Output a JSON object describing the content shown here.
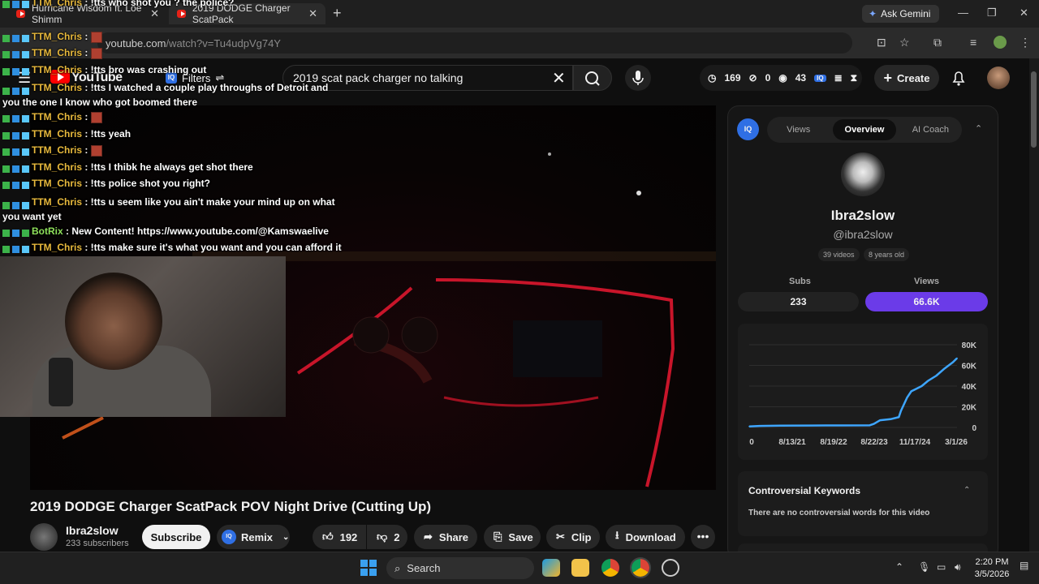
{
  "browser": {
    "tabs": [
      {
        "title": "Hurricane Wisdom ft. Loe Shimm"
      },
      {
        "title": "2019 DODGE Charger ScatPack"
      }
    ],
    "gemini_label": "Ask Gemini",
    "url_host": "youtube.com",
    "url_path": "/watch?v=Tu4udpVg74Y"
  },
  "youtube": {
    "logo_text": "YouTube",
    "filters_label": "Filters",
    "search_query": "2019 scat pack charger no talking",
    "stats": {
      "time": "169",
      "zero": "0",
      "count": "43"
    },
    "create_label": "Create"
  },
  "chat": [
    {
      "user": "TTM_Chris",
      "msg": " : !tts who shot you ? the police?",
      "emote": false
    },
    {
      "user": "TTM_Chris",
      "msg": " :",
      "emote": true
    },
    {
      "user": "TTM_Chris",
      "msg": " :",
      "emote": true
    },
    {
      "user": "TTM_Chris",
      "msg": " : !tts bro was crashing out",
      "emote": false
    },
    {
      "user": "TTM_Chris",
      "msg": " : !tts I watched a couple play throughs of Detroit and you the one I know who got boomed there",
      "emote": false
    },
    {
      "user": "TTM_Chris",
      "msg": " :",
      "emote": true
    },
    {
      "user": "TTM_Chris",
      "msg": " : !tts yeah",
      "emote": false
    },
    {
      "user": "TTM_Chris",
      "msg": " :",
      "emote": true
    },
    {
      "user": "TTM_Chris",
      "msg": " : !tts I thibk he always get shot there",
      "emote": false
    },
    {
      "user": "TTM_Chris",
      "msg": " : !tts police shot you right?",
      "emote": false
    },
    {
      "user": "TTM_Chris",
      "msg": " : !tts u seem like you ain't make your mind up on what you want yet",
      "emote": false
    },
    {
      "user": "BotRix",
      "msg": " : New Content! https://www.youtube.com/@Kamswaelive",
      "emote": false
    },
    {
      "user": "TTM_Chris",
      "msg": " : !tts make sure it's what you want and you can afford it",
      "emote": false
    }
  ],
  "video": {
    "title": "2019 DODGE Charger ScatPack POV Night Drive (Cutting Up)",
    "channel": "Ibra2slow",
    "subscribers": "233 subscribers",
    "subscribe_label": "Subscribe",
    "remix_label": "Remix",
    "likes": "192",
    "dislikes": "2",
    "share_label": "Share",
    "save_label": "Save",
    "clip_label": "Clip",
    "download_label": "Download"
  },
  "panel": {
    "tabs": [
      "Views",
      "Overview",
      "AI Coach"
    ],
    "active_tab": "Overview",
    "channel_name": "Ibra2slow",
    "handle": "@ibra2slow",
    "tags": [
      "39 videos",
      "8 years old"
    ],
    "subs_label": "Subs",
    "subs_value": "233",
    "views_label": "Views",
    "views_value": "66.6K",
    "kw_title": "Controversial Keywords",
    "kw_text": "There are no controversial words for this video"
  },
  "chart_data": {
    "type": "line",
    "x_labels": [
      "0",
      "8/13/21",
      "8/19/22",
      "8/22/23",
      "11/17/24",
      "3/1/26"
    ],
    "y_labels": [
      "80K",
      "60K",
      "40K",
      "20K",
      "0"
    ],
    "ylim": [
      0,
      80000
    ],
    "accent": "#3ea6ff",
    "series": [
      {
        "values": [
          [
            0,
            1000
          ],
          [
            0.05,
            1500
          ],
          [
            0.15,
            1800
          ],
          [
            0.3,
            1900
          ],
          [
            0.45,
            2000
          ],
          [
            0.58,
            2100
          ],
          [
            0.6,
            3500
          ],
          [
            0.63,
            7000
          ],
          [
            0.68,
            8000
          ],
          [
            0.72,
            10000
          ],
          [
            0.73,
            16000
          ],
          [
            0.76,
            29000
          ],
          [
            0.78,
            35000
          ],
          [
            0.8,
            37000
          ],
          [
            0.83,
            40000
          ],
          [
            0.86,
            45000
          ],
          [
            0.9,
            50000
          ],
          [
            0.94,
            57000
          ],
          [
            0.98,
            63000
          ],
          [
            1.0,
            67000
          ]
        ]
      }
    ]
  },
  "taskbar": {
    "search_label": "Search",
    "time": "2:20 PM",
    "date": "3/5/2026"
  }
}
